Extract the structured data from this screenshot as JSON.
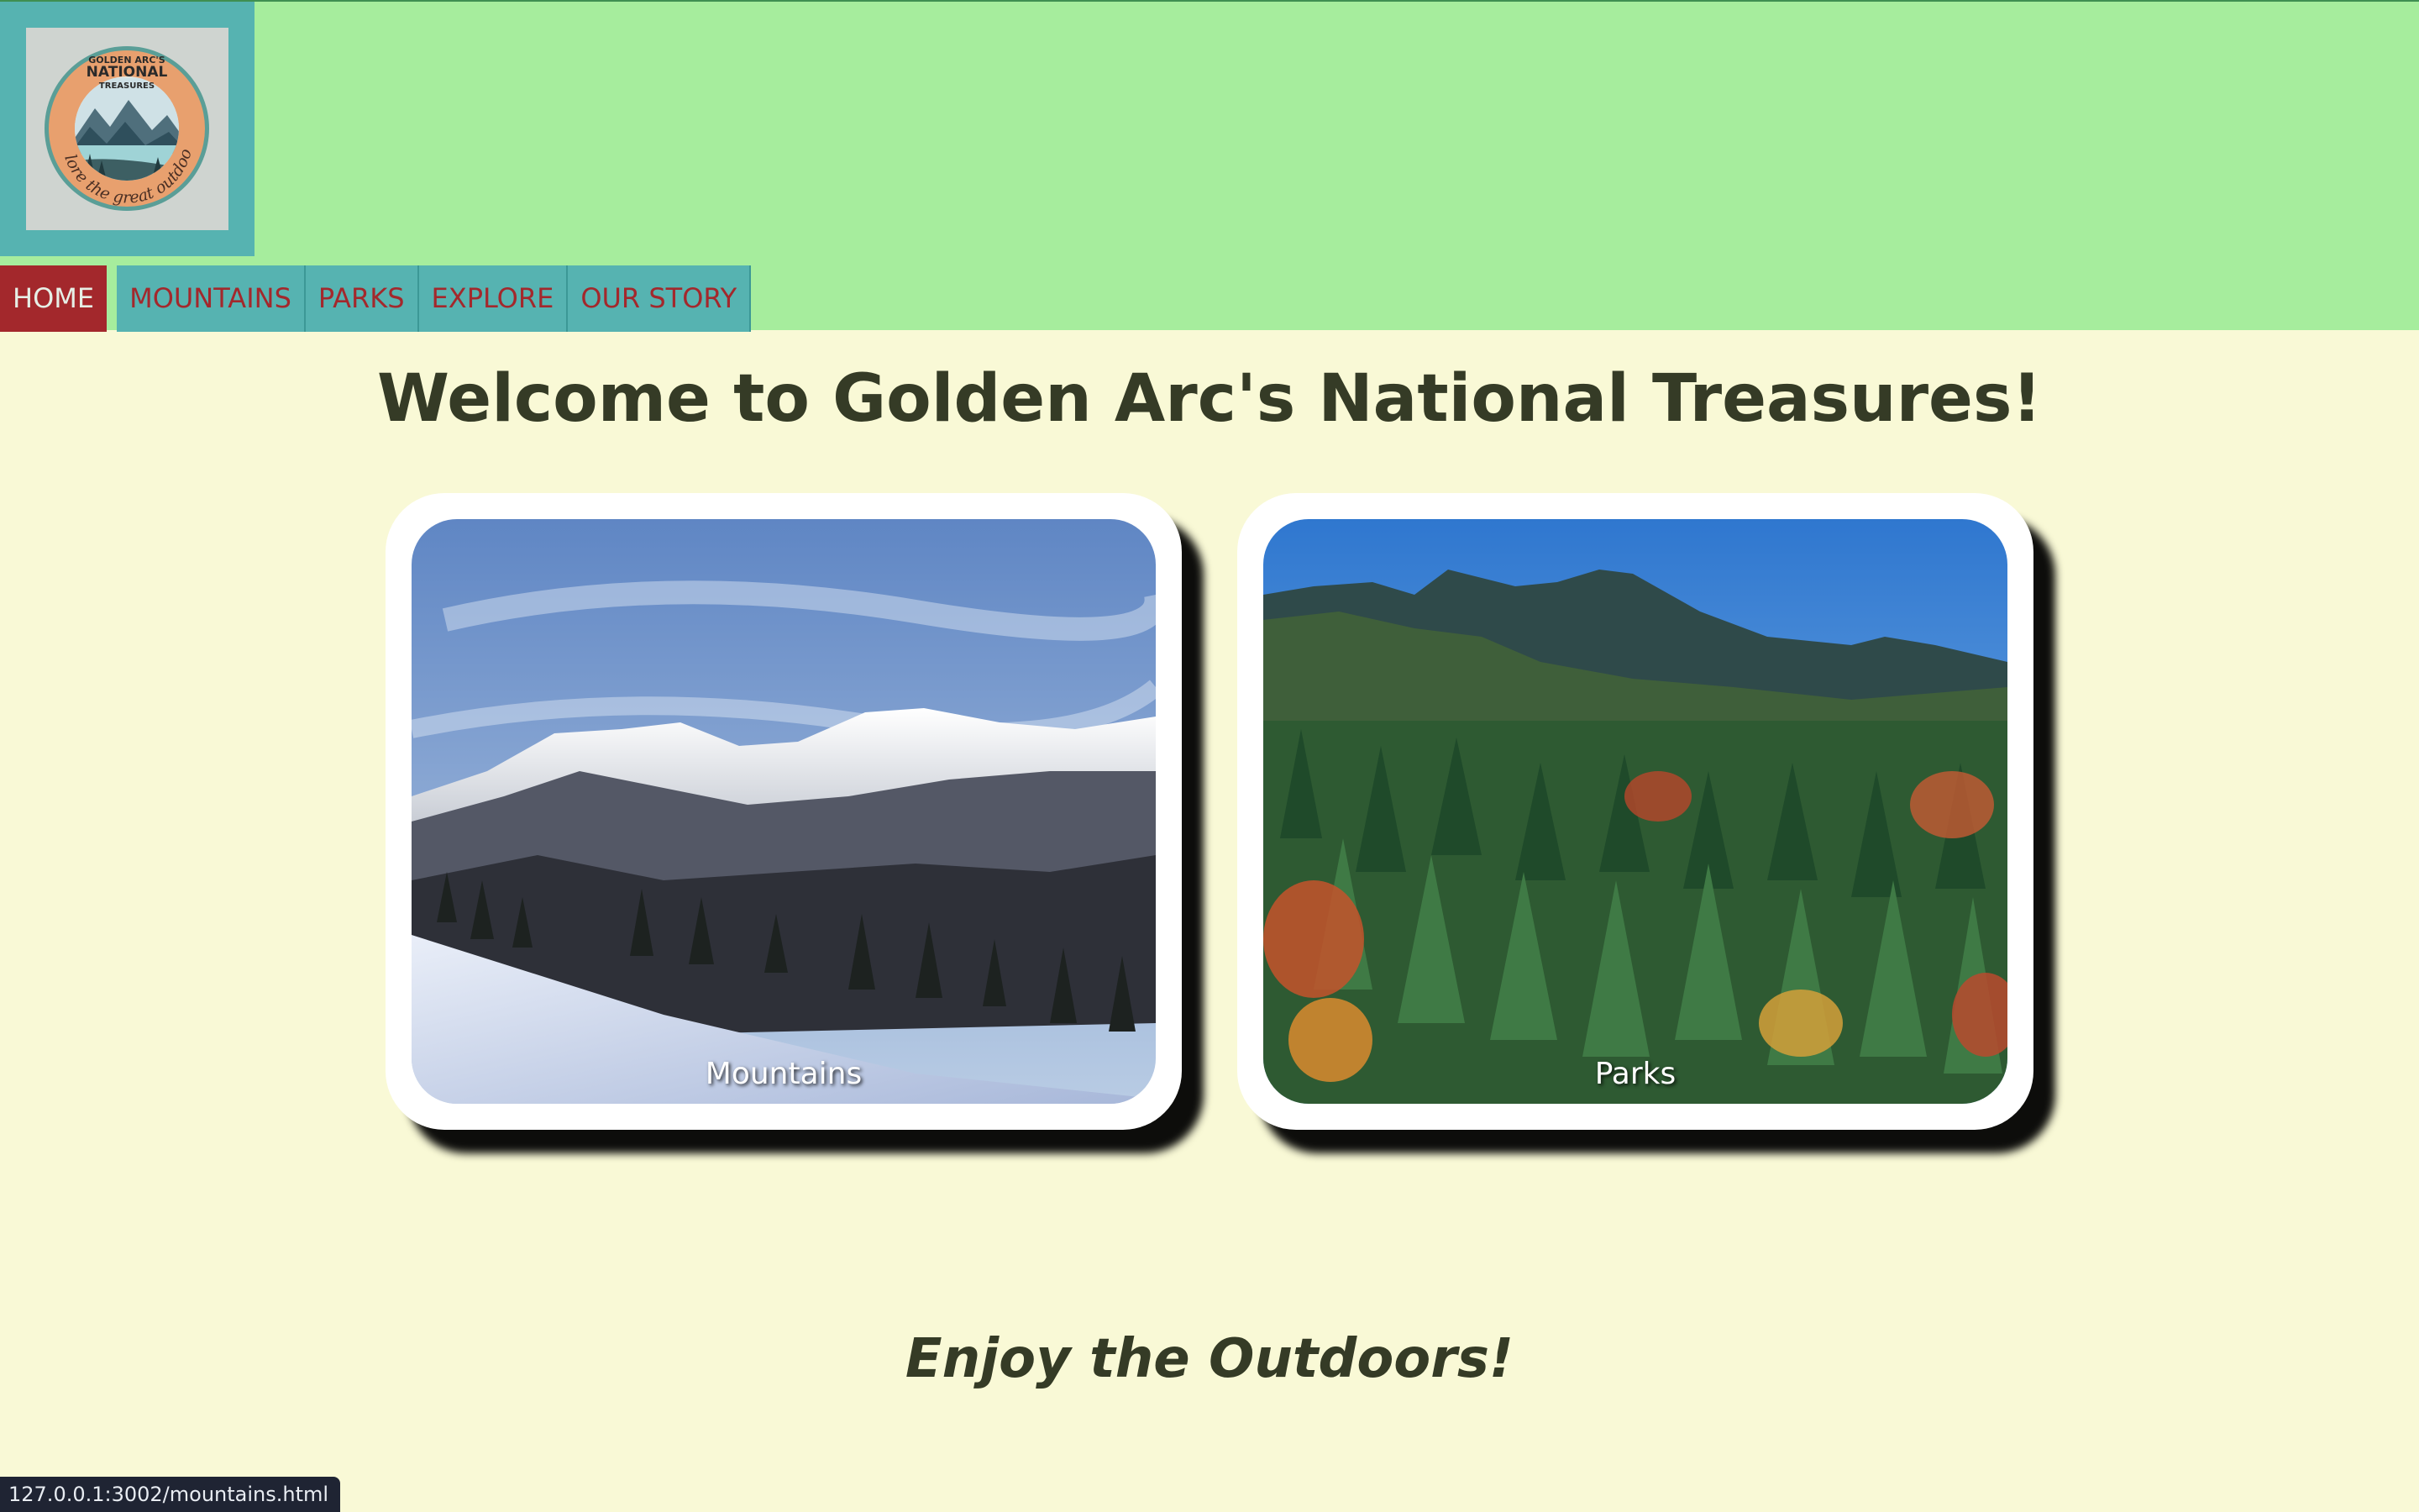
{
  "header": {
    "logo": {
      "line1": "GOLDEN ARC'S",
      "line2": "NATIONAL",
      "line3": "TREASURES",
      "ring_text": "explore the great outdoors!"
    },
    "nav": [
      {
        "label": "HOME",
        "active": true
      },
      {
        "label": "MOUNTAINS",
        "active": false
      },
      {
        "label": "PARKS",
        "active": false
      },
      {
        "label": "EXPLORE",
        "active": false
      },
      {
        "label": "OUR STORY",
        "active": false
      }
    ]
  },
  "main": {
    "title": "Welcome to Golden Arc's National Treasures!",
    "cards": [
      {
        "caption": "Mountains"
      },
      {
        "caption": "Parks"
      }
    ],
    "tagline": "Enjoy the Outdoors!"
  },
  "status_bar": {
    "url": "127.0.0.1:3002/mountains.html"
  },
  "colors": {
    "header_bg": "#a6ed9d",
    "page_bg": "#f9f9d6",
    "nav_bg": "#56b3b1",
    "nav_text": "#a3282c",
    "nav_active_bg": "#a3282c",
    "title_text": "#353b26"
  }
}
